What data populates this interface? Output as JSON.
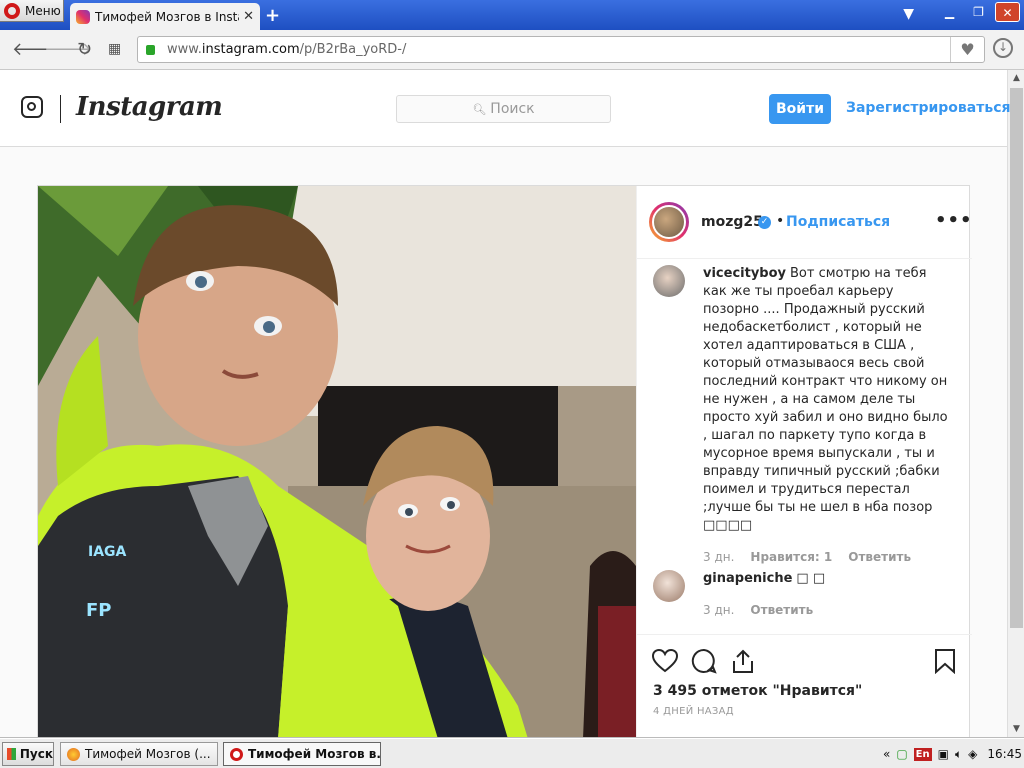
{
  "browser": {
    "menu_label": "Меню",
    "tab_title": "Тимофей Мозгов в Instagram",
    "tab_close": "✕",
    "new_tab": "+",
    "url_prefix": "www.",
    "url_domain": "instagram.com",
    "url_path": "/p/B2rBa_yoRD-/",
    "win_min": "▁",
    "win_max": "❐",
    "win_close": "✕"
  },
  "header": {
    "logo_text": "Instagram",
    "search_placeholder": "Поиск",
    "login_label": "Войти",
    "signup_label": "Зарегистрироваться"
  },
  "post": {
    "author": "mozg25",
    "verified": true,
    "dot": "•",
    "follow_label": "Подписаться",
    "more_label": "•••",
    "comments": [
      {
        "user": "vicecityboy",
        "text": "Вот смотрю на тебя как же ты проебал карьеру позорно .... Продажный русский недобаскетболист , который не хотел адаптироваться в США , который отмазываося весь свой последний контракт что никому он не нужен , а на самом деле ты просто хуй забил и оно видно было , шагал по паркету тупо когда в мусорное время выпускали , ты и вправду типичный русский ;бабки поимел и трудиться перестал ;лучше бы ты не шел в нба позор □□□□",
        "time": "3 дн.",
        "likes": "Нравится: 1",
        "reply": "Ответить"
      },
      {
        "user": "ginapeniche",
        "text": "□ □",
        "time": "3 дн.",
        "reply": "Ответить"
      }
    ],
    "likes_text": "3 495 отметок \"Нравится\"",
    "date_text": "4 ДНЕЙ НАЗАД"
  },
  "taskbar": {
    "start_label": "Пуск",
    "task1_label": "Тимофей Мозгов (...",
    "task2_label": "Тимофей Мозгов в...",
    "lang": "En",
    "time": "16:45"
  },
  "colors": {
    "accent": "#3897f0",
    "titlebar": "#2b5fd6",
    "text": "#262626",
    "muted": "#999999"
  }
}
